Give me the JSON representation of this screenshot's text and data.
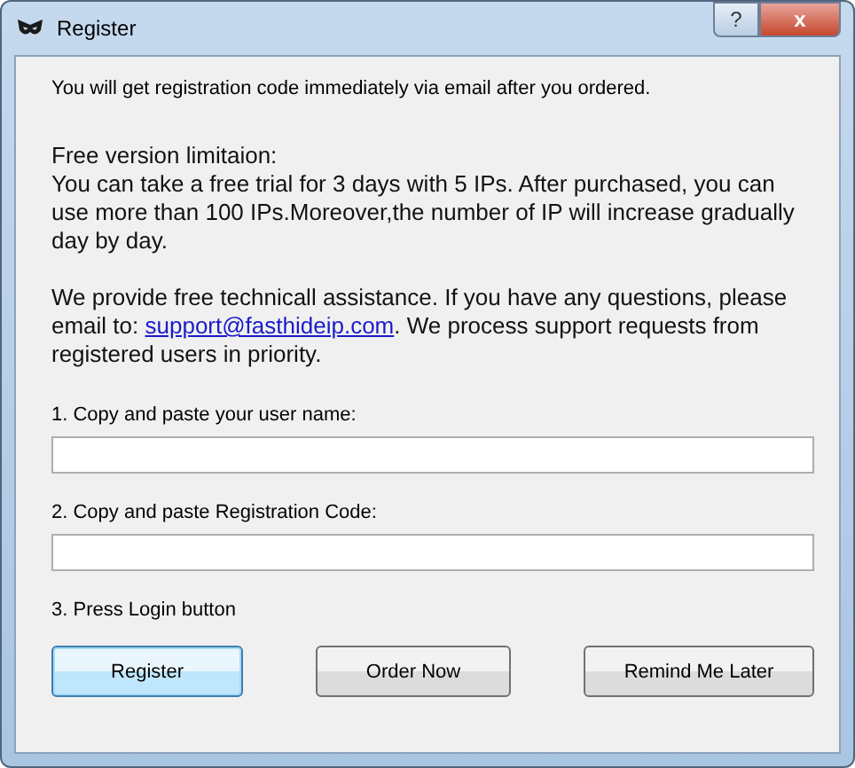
{
  "window": {
    "title": "Register",
    "controls": [
      {
        "kind": "help",
        "label": "?"
      },
      {
        "kind": "close",
        "label": "x"
      }
    ]
  },
  "notice": "You will get registration code immediately via email after you ordered.",
  "limitation": {
    "heading": "Free version limitaion:",
    "text": "You can take a free trial for 3 days with 5 IPs. After purchased, you can use more than 100 IPs.Moreover,the number of IP will increase gradually day by day."
  },
  "support": {
    "before": "We provide free technicall assistance. If you have any questions, please email to: ",
    "link": "support@fasthideip.com",
    "after": ". We process support requests from registered users in priority."
  },
  "steps": [
    {
      "kind": "field",
      "label": "1. Copy and paste your user name:"
    },
    {
      "kind": "field",
      "label": "2. Copy and paste Registration Code:"
    },
    {
      "kind": "text",
      "label": "3. Press Login button"
    }
  ],
  "buttons": [
    {
      "label": "Register",
      "default": true
    },
    {
      "label": "Order Now",
      "default": false
    },
    {
      "label": "Remind Me Later",
      "default": false
    }
  ]
}
